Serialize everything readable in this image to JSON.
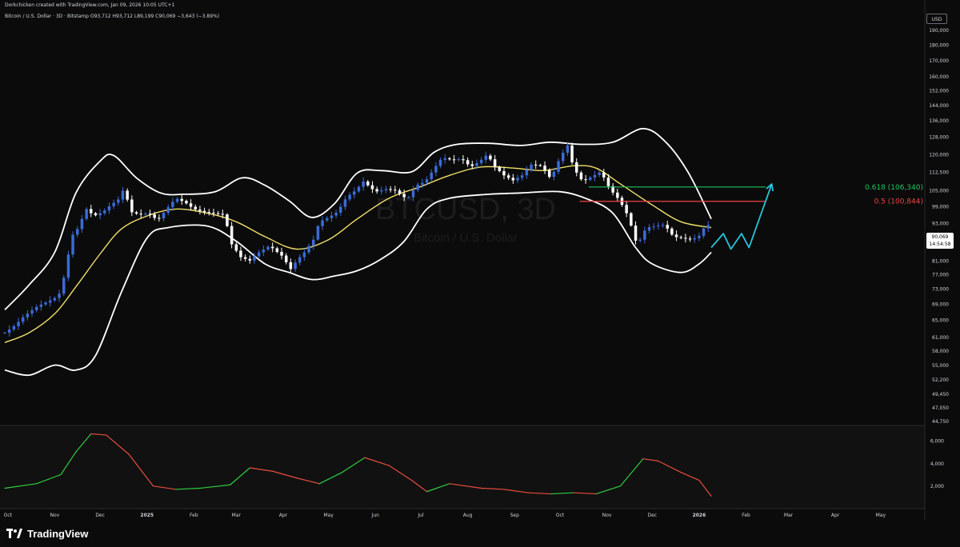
{
  "header": {
    "credit": "Dorkchicken created with TradingView.com, Jan 09, 2026 10:05 UTC+1",
    "symbol_line": "Bitcoin / U.S. Dollar · 3D · Bitstamp",
    "ohlc_line": "O93,712 H93,712 L89,199 C90,069 −3,643 (−3.89%)"
  },
  "watermark": {
    "ticker": "BTCUSD, 3D",
    "name": "Bitcoin / U.S. Dollar"
  },
  "brand": {
    "name": "TradingView"
  },
  "price_scale": {
    "currency": "USD",
    "last_price": "90,069",
    "countdown": "14:54:58"
  },
  "colors": {
    "up": "#3a6bd6",
    "down": "#ffffff",
    "bands": "#ffffff",
    "basis": "#f0df6a",
    "fib_0618": "#22c55e",
    "fib_05": "#ef4444",
    "projection": "#26c6da",
    "osc_up": "#2ecc40",
    "osc_down": "#e74c3c"
  },
  "chart_data": [
    {
      "type": "candlestick",
      "title": "",
      "scale": "log",
      "ylim": [
        44000,
        205000
      ],
      "y_ticks": [
        {
          "value": 190000,
          "label": "190,000"
        },
        {
          "value": 180000,
          "label": "180,000"
        },
        {
          "value": 170000,
          "label": "170,000"
        },
        {
          "value": 160000,
          "label": "160,000"
        },
        {
          "value": 152000,
          "label": "152,000"
        },
        {
          "value": 144000,
          "label": "144,000"
        },
        {
          "value": 136000,
          "label": "136,000"
        },
        {
          "value": 128000,
          "label": "128,000"
        },
        {
          "value": 120000,
          "label": "120,000"
        },
        {
          "value": 112500,
          "label": "112,500"
        },
        {
          "value": 105000,
          "label": "105,000"
        },
        {
          "value": 99000,
          "label": "99,000"
        },
        {
          "value": 93000,
          "label": "93,000"
        },
        {
          "value": 87000,
          "label": "87,000"
        },
        {
          "value": 81000,
          "label": "81,000"
        },
        {
          "value": 77000,
          "label": "77,000"
        },
        {
          "value": 73000,
          "label": "73,000"
        },
        {
          "value": 69000,
          "label": "69,000"
        },
        {
          "value": 65000,
          "label": "65,000"
        },
        {
          "value": 61000,
          "label": "61,000"
        },
        {
          "value": 58000,
          "label": "58,000"
        },
        {
          "value": 55000,
          "label": "55,000"
        },
        {
          "value": 52200,
          "label": "52,200"
        },
        {
          "value": 49450,
          "label": "49,450"
        },
        {
          "value": 47050,
          "label": "47,050"
        },
        {
          "value": 44750,
          "label": "44,750"
        }
      ],
      "x_ticks": [
        {
          "date": "2024-10-01",
          "label": "Oct"
        },
        {
          "date": "2024-11-01",
          "label": "Nov"
        },
        {
          "date": "2024-12-01",
          "label": "Dec"
        },
        {
          "date": "2025-01-01",
          "label": "2025"
        },
        {
          "date": "2025-02-01",
          "label": "Feb"
        },
        {
          "date": "2025-03-01",
          "label": "Mar"
        },
        {
          "date": "2025-04-01",
          "label": "Apr"
        },
        {
          "date": "2025-05-01",
          "label": "May"
        },
        {
          "date": "2025-06-01",
          "label": "Jun"
        },
        {
          "date": "2025-07-01",
          "label": "Jul"
        },
        {
          "date": "2025-08-01",
          "label": "Aug"
        },
        {
          "date": "2025-09-01",
          "label": "Sep"
        },
        {
          "date": "2025-10-01",
          "label": "Oct"
        },
        {
          "date": "2025-11-01",
          "label": "Nov"
        },
        {
          "date": "2025-12-01",
          "label": "Dec"
        },
        {
          "date": "2026-01-01",
          "label": "2026"
        },
        {
          "date": "2026-02-01",
          "label": "Feb"
        },
        {
          "date": "2026-03-01",
          "label": "Mar"
        },
        {
          "date": "2026-04-01",
          "label": "Apr"
        },
        {
          "date": "2026-05-01",
          "label": "May"
        }
      ],
      "xlim": [
        "2024-09-29",
        "2026-05-27"
      ],
      "close_path": [
        [
          "2024-09-29",
          62000
        ],
        [
          "2024-10-05",
          63500
        ],
        [
          "2024-10-12",
          66000
        ],
        [
          "2024-10-21",
          68500
        ],
        [
          "2024-10-27",
          69500
        ],
        [
          "2024-11-01",
          70500
        ],
        [
          "2024-11-05",
          72000
        ],
        [
          "2024-11-09",
          80000
        ],
        [
          "2024-11-12",
          88500
        ],
        [
          "2024-11-16",
          91000
        ],
        [
          "2024-11-22",
          98000
        ],
        [
          "2024-11-27",
          95500
        ],
        [
          "2024-12-03",
          97000
        ],
        [
          "2024-12-08",
          99500
        ],
        [
          "2024-12-13",
          101500
        ],
        [
          "2024-12-17",
          106000
        ],
        [
          "2024-12-21",
          97000
        ],
        [
          "2024-12-27",
          96000
        ],
        [
          "2025-01-02",
          96500
        ],
        [
          "2025-01-08",
          94000
        ],
        [
          "2025-01-14",
          98000
        ],
        [
          "2025-01-20",
          102000
        ],
        [
          "2025-01-26",
          100500
        ],
        [
          "2025-02-01",
          98000
        ],
        [
          "2025-02-07",
          97000
        ],
        [
          "2025-02-14",
          96500
        ],
        [
          "2025-02-21",
          96000
        ],
        [
          "2025-02-26",
          86000
        ],
        [
          "2025-03-04",
          82000
        ],
        [
          "2025-03-10",
          81000
        ],
        [
          "2025-03-16",
          83500
        ],
        [
          "2025-03-23",
          85500
        ],
        [
          "2025-03-31",
          82500
        ],
        [
          "2025-04-06",
          78500
        ],
        [
          "2025-04-10",
          81000
        ],
        [
          "2025-04-15",
          83500
        ],
        [
          "2025-04-21",
          87500
        ],
        [
          "2025-04-25",
          93500
        ],
        [
          "2025-05-01",
          95000
        ],
        [
          "2025-05-07",
          97000
        ],
        [
          "2025-05-13",
          102500
        ],
        [
          "2025-05-19",
          105000
        ],
        [
          "2025-05-24",
          108500
        ],
        [
          "2025-06-01",
          104500
        ],
        [
          "2025-06-08",
          105500
        ],
        [
          "2025-06-14",
          105000
        ],
        [
          "2025-06-22",
          101500
        ],
        [
          "2025-06-28",
          107000
        ],
        [
          "2025-07-04",
          108500
        ],
        [
          "2025-07-10",
          114000
        ],
        [
          "2025-07-15",
          118500
        ],
        [
          "2025-07-22",
          117500
        ],
        [
          "2025-07-28",
          118000
        ],
        [
          "2025-08-03",
          114500
        ],
        [
          "2025-08-09",
          117000
        ],
        [
          "2025-08-14",
          120000
        ],
        [
          "2025-08-19",
          114500
        ],
        [
          "2025-08-25",
          111000
        ],
        [
          "2025-08-31",
          109000
        ],
        [
          "2025-09-06",
          111000
        ],
        [
          "2025-09-12",
          115500
        ],
        [
          "2025-09-19",
          115000
        ],
        [
          "2025-09-25",
          109500
        ],
        [
          "2025-10-01",
          118500
        ],
        [
          "2025-10-06",
          124000
        ],
        [
          "2025-10-10",
          114000
        ],
        [
          "2025-10-16",
          108500
        ],
        [
          "2025-10-22",
          110500
        ],
        [
          "2025-10-28",
          112500
        ],
        [
          "2025-11-03",
          105500
        ],
        [
          "2025-11-09",
          101500
        ],
        [
          "2025-11-15",
          95500
        ],
        [
          "2025-11-21",
          85500
        ],
        [
          "2025-11-27",
          91500
        ],
        [
          "2025-12-03",
          92000
        ],
        [
          "2025-12-09",
          92500
        ],
        [
          "2025-12-15",
          88500
        ],
        [
          "2025-12-21",
          88000
        ],
        [
          "2025-12-27",
          87500
        ],
        [
          "2026-01-02",
          89000
        ],
        [
          "2026-01-06",
          93500
        ],
        [
          "2026-01-09",
          90069
        ]
      ],
      "bollinger": {
        "basis": [
          [
            "2024-09-29",
            59800
          ],
          [
            "2024-10-15",
            62000
          ],
          [
            "2024-11-01",
            66500
          ],
          [
            "2024-11-15",
            73500
          ],
          [
            "2024-12-01",
            83000
          ],
          [
            "2024-12-15",
            91000
          ],
          [
            "2025-01-01",
            95500
          ],
          [
            "2025-01-20",
            98000
          ],
          [
            "2025-02-10",
            96500
          ],
          [
            "2025-03-01",
            93500
          ],
          [
            "2025-03-20",
            88500
          ],
          [
            "2025-04-10",
            84500
          ],
          [
            "2025-05-01",
            87500
          ],
          [
            "2025-05-20",
            94500
          ],
          [
            "2025-06-10",
            102000
          ],
          [
            "2025-07-01",
            106500
          ],
          [
            "2025-07-20",
            111000
          ],
          [
            "2025-08-10",
            114500
          ],
          [
            "2025-09-01",
            114000
          ],
          [
            "2025-09-20",
            113000
          ],
          [
            "2025-10-10",
            115000
          ],
          [
            "2025-10-25",
            114000
          ],
          [
            "2025-11-10",
            107500
          ],
          [
            "2025-12-01",
            99500
          ],
          [
            "2025-12-20",
            93500
          ],
          [
            "2026-01-09",
            91500
          ]
        ],
        "upper": [
          [
            "2024-09-29",
            67500
          ],
          [
            "2024-10-15",
            74000
          ],
          [
            "2024-11-01",
            83500
          ],
          [
            "2024-11-15",
            104000
          ],
          [
            "2024-12-01",
            117000
          ],
          [
            "2024-12-10",
            119500
          ],
          [
            "2024-12-25",
            110000
          ],
          [
            "2025-01-10",
            104000
          ],
          [
            "2025-01-25",
            103500
          ],
          [
            "2025-02-15",
            104500
          ],
          [
            "2025-03-05",
            110000
          ],
          [
            "2025-03-20",
            107000
          ],
          [
            "2025-04-05",
            101000
          ],
          [
            "2025-04-20",
            95000
          ],
          [
            "2025-05-05",
            100000
          ],
          [
            "2025-05-20",
            112000
          ],
          [
            "2025-06-05",
            113000
          ],
          [
            "2025-06-25",
            112500
          ],
          [
            "2025-07-10",
            121000
          ],
          [
            "2025-07-25",
            124500
          ],
          [
            "2025-08-15",
            125000
          ],
          [
            "2025-09-05",
            124000
          ],
          [
            "2025-09-25",
            125500
          ],
          [
            "2025-10-15",
            124500
          ],
          [
            "2025-11-05",
            125500
          ],
          [
            "2025-11-25",
            132000
          ],
          [
            "2025-12-10",
            125500
          ],
          [
            "2025-12-25",
            112000
          ],
          [
            "2026-01-09",
            94500
          ]
        ],
        "lower": [
          [
            "2024-09-29",
            54000
          ],
          [
            "2024-10-15",
            53000
          ],
          [
            "2024-11-01",
            55000
          ],
          [
            "2024-11-15",
            54000
          ],
          [
            "2024-11-28",
            57000
          ],
          [
            "2024-12-15",
            72000
          ],
          [
            "2025-01-01",
            88000
          ],
          [
            "2025-01-15",
            91500
          ],
          [
            "2025-02-10",
            92000
          ],
          [
            "2025-03-01",
            87000
          ],
          [
            "2025-03-20",
            80000
          ],
          [
            "2025-04-05",
            77500
          ],
          [
            "2025-04-20",
            75500
          ],
          [
            "2025-05-05",
            76500
          ],
          [
            "2025-05-20",
            78000
          ],
          [
            "2025-06-05",
            81500
          ],
          [
            "2025-06-20",
            87000
          ],
          [
            "2025-07-05",
            98000
          ],
          [
            "2025-07-20",
            102000
          ],
          [
            "2025-08-15",
            103500
          ],
          [
            "2025-09-05",
            104000
          ],
          [
            "2025-10-01",
            104500
          ],
          [
            "2025-10-20",
            101500
          ],
          [
            "2025-11-05",
            96500
          ],
          [
            "2025-11-20",
            85000
          ],
          [
            "2025-12-01",
            80000
          ],
          [
            "2025-12-20",
            77500
          ],
          [
            "2026-01-01",
            80000
          ],
          [
            "2026-01-09",
            83500
          ]
        ]
      },
      "fib_levels": [
        {
          "value": 106340,
          "label": "0.618 (106,340)",
          "from": "2025-10-20",
          "to": "2026-02-14"
        },
        {
          "value": 100844,
          "label": "0.5 (100,844)",
          "from": "2025-10-14",
          "to": "2026-02-14"
        }
      ],
      "projection": [
        [
          "2026-01-09",
          85000
        ],
        [
          "2026-01-17",
          89500
        ],
        [
          "2026-01-22",
          84500
        ],
        [
          "2026-01-29",
          89500
        ],
        [
          "2026-02-03",
          85000
        ],
        [
          "2026-02-18",
          107500
        ]
      ]
    },
    {
      "type": "line",
      "title": "",
      "ylim": [
        0,
        7200
      ],
      "y_ticks": [
        {
          "value": 6000,
          "label": "6,000"
        },
        {
          "value": 4000,
          "label": "4,000"
        },
        {
          "value": 2000,
          "label": "2,000"
        }
      ],
      "x": [
        "2024-09-29",
        "2024-10-20",
        "2024-11-05",
        "2024-11-15",
        "2024-11-25",
        "2024-12-05",
        "2024-12-20",
        "2025-01-05",
        "2025-01-20",
        "2025-02-05",
        "2025-02-25",
        "2025-03-10",
        "2025-03-25",
        "2025-04-10",
        "2025-04-25",
        "2025-05-10",
        "2025-05-25",
        "2025-06-10",
        "2025-06-25",
        "2025-07-05",
        "2025-07-20",
        "2025-08-10",
        "2025-08-25",
        "2025-09-10",
        "2025-09-25",
        "2025-10-10",
        "2025-10-25",
        "2025-11-10",
        "2025-11-25",
        "2025-12-05",
        "2025-12-20",
        "2026-01-01",
        "2026-01-09"
      ],
      "values": [
        1800,
        2200,
        3000,
        5000,
        6600,
        6500,
        4800,
        2000,
        1700,
        1800,
        2100,
        3600,
        3300,
        2700,
        2200,
        3200,
        4500,
        3800,
        2500,
        1500,
        2200,
        1800,
        1700,
        1400,
        1300,
        1400,
        1300,
        2000,
        4400,
        4200,
        3200,
        2500,
        1100
      ]
    }
  ]
}
